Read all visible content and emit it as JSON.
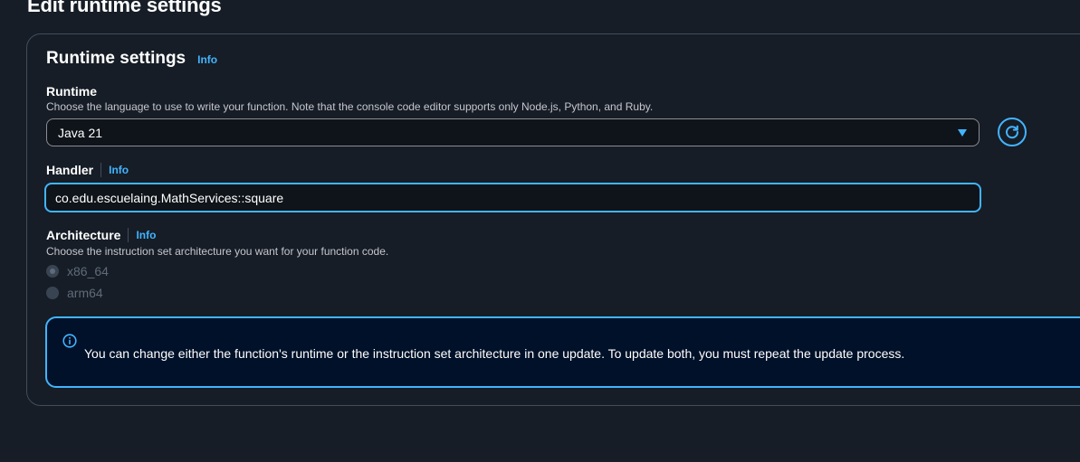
{
  "page": {
    "title": "Edit runtime settings"
  },
  "panel": {
    "title": "Runtime settings",
    "info_label": "Info"
  },
  "runtime": {
    "label": "Runtime",
    "description": "Choose the language to use to write your function. Note that the console code editor supports only Node.js, Python, and Ruby.",
    "selected_value": "Java 21",
    "caret_icon": "caret-down-icon",
    "refresh_icon": "refresh-icon"
  },
  "handler": {
    "label": "Handler",
    "info_label": "Info",
    "value": "co.edu.escuelaing.MathServices::square"
  },
  "architecture": {
    "label": "Architecture",
    "info_label": "Info",
    "description": "Choose the instruction set architecture you want for your function code.",
    "options": [
      {
        "label": "x86_64",
        "checked": true,
        "disabled": true
      },
      {
        "label": "arm64",
        "checked": false,
        "disabled": true
      }
    ]
  },
  "alert": {
    "icon": "info-circle-icon",
    "message": "You can change either the function's runtime or the instruction set architecture in one update. To update both, you must repeat the update process."
  },
  "colors": {
    "background": "#161d26",
    "accent": "#42b4ff",
    "alert_background": "#001129",
    "border": "#414d5c",
    "disabled_text": "#5f6b7a"
  }
}
